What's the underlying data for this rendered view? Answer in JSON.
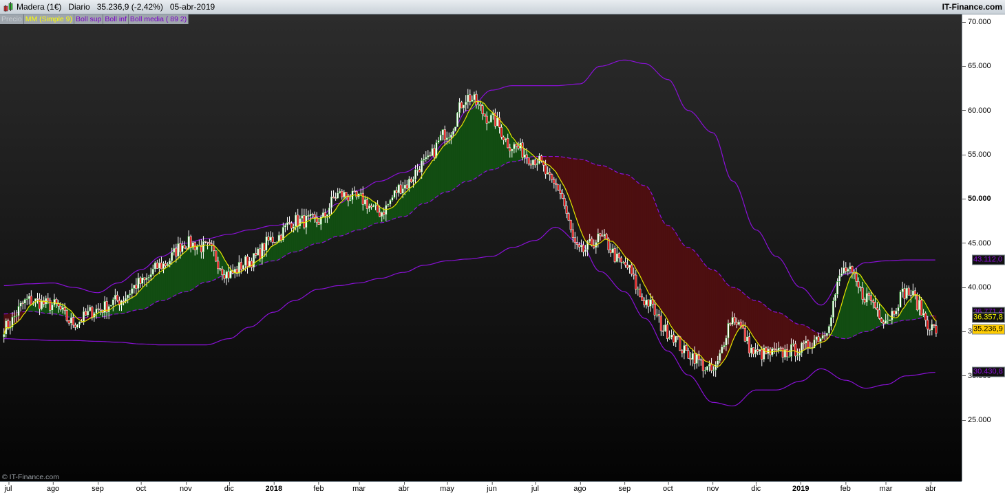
{
  "header": {
    "instrument": "Madera (1€)",
    "period": "Diario",
    "last": "35.236,9 (-2,42%)",
    "date": "05-abr-2019",
    "brand": "IT-Finance.com"
  },
  "legend": [
    {
      "label": "Precio",
      "color": "#c8cdd2"
    },
    {
      "label": "MM (Simple 9)",
      "color": "#ffff00"
    },
    {
      "label": "Boll sup",
      "color": "#7a00c8"
    },
    {
      "label": "Boll inf",
      "color": "#7a00c8"
    },
    {
      "label": "Boll media ( 89 2)",
      "color": "#7a00c8"
    }
  ],
  "copyright": "© IT-Finance.com",
  "colors": {
    "up": "#ffffff",
    "up_edge": "#1fa51f",
    "down": "#e01010",
    "ma": "#e6e600",
    "band": "#8a10d8",
    "fill_up": "#124d12",
    "fill_down": "#4d0f10"
  },
  "price_labels": [
    {
      "value": "43.112,0",
      "color": "#8a10d8",
      "bg": "#111",
      "v": 43.112
    },
    {
      "value": "36.771,4",
      "color": "#8a10d8",
      "bg": "#111",
      "v": 36.771
    },
    {
      "value": "36.357,8",
      "color": "#ffff00",
      "bg": "#111",
      "v": 36.358
    },
    {
      "value": "35.236,9",
      "color": "#000",
      "bg": "#ffcc00",
      "v": 35.237
    },
    {
      "value": "30.430,8",
      "color": "#8a10d8",
      "bg": "#111",
      "v": 30.431
    }
  ],
  "chart_data": {
    "type": "candlestick",
    "ylim": [
      20,
      71
    ],
    "y_ticks": [
      "70.000",
      "65.000",
      "60.000",
      "55.000",
      "50.000",
      "45.000",
      "40.000",
      "35.000",
      "30.000",
      "25.000"
    ],
    "x_ticks": [
      {
        "label": "jul",
        "date": "2017-07-01"
      },
      {
        "label": "ago",
        "date": "2017-08-01"
      },
      {
        "label": "sep",
        "date": "2017-09-01"
      },
      {
        "label": "oct",
        "date": "2017-10-01"
      },
      {
        "label": "nov",
        "date": "2017-11-01"
      },
      {
        "label": "dic",
        "date": "2017-12-01"
      },
      {
        "label": "2018",
        "date": "2018-01-01",
        "bold": true
      },
      {
        "label": "feb",
        "date": "2018-02-01"
      },
      {
        "label": "mar",
        "date": "2018-03-01"
      },
      {
        "label": "abr",
        "date": "2018-04-01"
      },
      {
        "label": "may",
        "date": "2018-05-01"
      },
      {
        "label": "jun",
        "date": "2018-06-01"
      },
      {
        "label": "jul",
        "date": "2018-07-01"
      },
      {
        "label": "ago",
        "date": "2018-08-01"
      },
      {
        "label": "sep",
        "date": "2018-09-01"
      },
      {
        "label": "oct",
        "date": "2018-10-01"
      },
      {
        "label": "nov",
        "date": "2018-11-01"
      },
      {
        "label": "dic",
        "date": "2018-12-01"
      },
      {
        "label": "2019",
        "date": "2019-01-01",
        "bold": true
      },
      {
        "label": "feb",
        "date": "2019-02-01"
      },
      {
        "label": "mar",
        "date": "2019-03-01"
      },
      {
        "label": "abr",
        "date": "2019-04-01"
      }
    ],
    "dates": [
      "2017-06-28",
      "2017-07-15",
      "2017-08-01",
      "2017-08-15",
      "2017-09-01",
      "2017-09-15",
      "2017-10-01",
      "2017-10-15",
      "2017-11-01",
      "2017-11-15",
      "2017-12-01",
      "2017-12-15",
      "2018-01-01",
      "2018-01-15",
      "2018-02-01",
      "2018-02-15",
      "2018-03-01",
      "2018-03-15",
      "2018-04-01",
      "2018-04-15",
      "2018-05-01",
      "2018-05-15",
      "2018-06-01",
      "2018-06-15",
      "2018-07-01",
      "2018-07-15",
      "2018-08-01",
      "2018-08-15",
      "2018-09-01",
      "2018-09-15",
      "2018-10-01",
      "2018-10-15",
      "2018-11-01",
      "2018-11-15",
      "2018-12-01",
      "2018-12-15",
      "2019-01-01",
      "2019-01-15",
      "2019-02-01",
      "2019-02-15",
      "2019-03-01",
      "2019-03-15",
      "2019-04-05"
    ],
    "series": [
      {
        "name": "Precio",
        "values": [
          35.5,
          38.5,
          38,
          36,
          37.5,
          38.5,
          40.5,
          42.5,
          45,
          44.5,
          41.5,
          43,
          45.5,
          47.5,
          47.5,
          50.5,
          50,
          48.5,
          51.5,
          54,
          57.5,
          61.5,
          59,
          56,
          54.5,
          51.5,
          44,
          45.5,
          42.5,
          38.5,
          35,
          32.5,
          30.5,
          36.5,
          32.5,
          32.5,
          33,
          34.5,
          42,
          39,
          36.5,
          39.5,
          35.2
        ]
      },
      {
        "name": "Boll sup",
        "values": [
          40.2,
          40.4,
          40.5,
          40,
          39.4,
          40.5,
          42,
          43.5,
          45,
          45.5,
          46,
          46.5,
          47,
          47.3,
          48,
          49.5,
          51,
          52,
          53,
          54,
          56.5,
          60,
          62.3,
          62.8,
          62.8,
          62.8,
          63,
          65,
          65.7,
          65.3,
          63.5,
          60,
          57.5,
          52,
          46.5,
          43.5,
          40,
          38,
          41.5,
          42.8,
          43,
          43.1,
          43.1
        ]
      },
      {
        "name": "Boll media ( 89 2)",
        "values": [
          37,
          37.3,
          37,
          36.6,
          36.6,
          37,
          37.5,
          38.5,
          39.5,
          40.6,
          41.5,
          42.3,
          43,
          44,
          45,
          45.8,
          46.5,
          47.3,
          48,
          49.5,
          50.8,
          52,
          53.3,
          54.2,
          54.8,
          54.8,
          54.5,
          53.8,
          52.8,
          51.5,
          47,
          44.5,
          42,
          40,
          38.5,
          37.2,
          35.8,
          34.8,
          34.2,
          35,
          35.8,
          36.3,
          36.8
        ]
      },
      {
        "name": "Boll inf",
        "values": [
          34.2,
          34.1,
          34,
          34,
          33.9,
          33.8,
          33.6,
          33.5,
          33.5,
          33.5,
          34.2,
          35.5,
          37.2,
          38.5,
          39.8,
          40.2,
          40.5,
          41,
          41.7,
          42.5,
          43,
          43.2,
          43.5,
          44.5,
          45.3,
          46.8,
          45,
          41.8,
          39.5,
          36.5,
          32.8,
          30.1,
          27,
          26.6,
          28.4,
          28.4,
          29.4,
          30.8,
          29.5,
          28.6,
          29,
          30,
          30.4
        ]
      }
    ],
    "moving_average": "MM (Simple 9)",
    "grid": false
  }
}
